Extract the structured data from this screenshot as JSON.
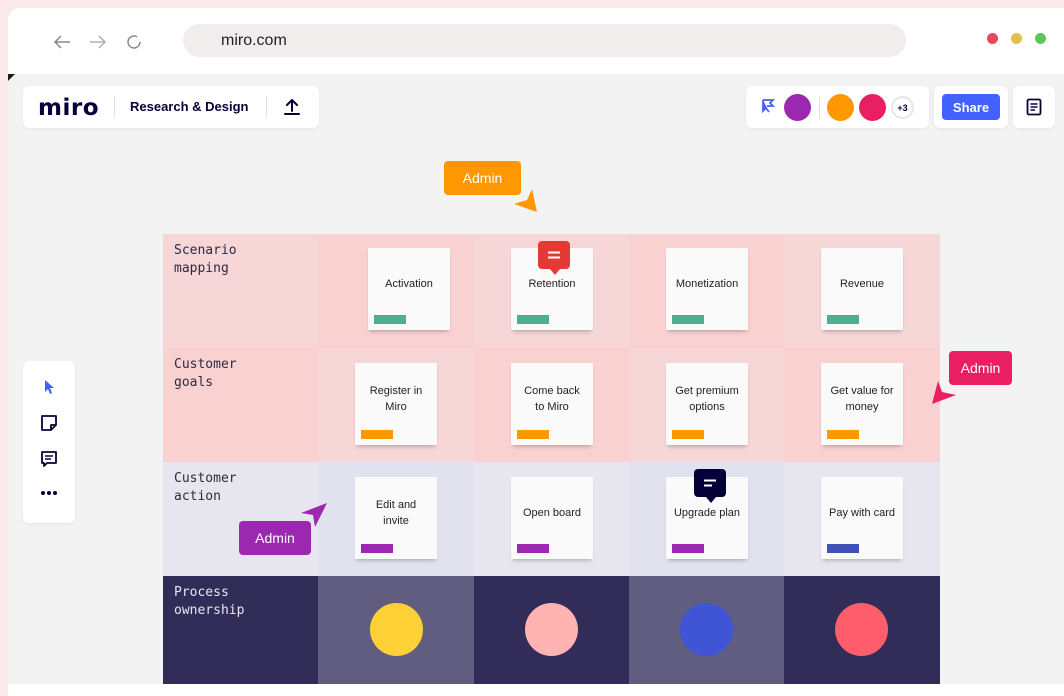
{
  "browser": {
    "url": "miro.com",
    "back_icon": "arrow-left-icon",
    "forward_icon": "arrow-right-icon",
    "reload_icon": "reload-icon",
    "window_dots": [
      "#e9485a",
      "#e0c14a",
      "#5ac85a"
    ]
  },
  "header": {
    "logo": "miro",
    "board_name": "Research & Design",
    "upload_icon": "upload-icon"
  },
  "collaborators": {
    "more_count": "+3",
    "avatar_colors": [
      "#9c27b0",
      "#ff9800",
      "#e91e63"
    ]
  },
  "share": {
    "label": "Share"
  },
  "toolbar": {
    "tools": [
      "cursor-icon",
      "sticky-note-icon",
      "comment-icon",
      "more-icon"
    ]
  },
  "board": {
    "rows": [
      {
        "label": "Scenario\nmapping",
        "stickies": [
          "Activation",
          "Retention",
          "Monetization",
          "Revenue"
        ],
        "tag_colors": [
          "#4caf8f",
          "#4caf8f",
          "#4caf8f",
          "#4caf8f"
        ]
      },
      {
        "label": "Customer\ngoals",
        "stickies": [
          "Register in\nMiro",
          "Come back\nto Miro",
          "Get premium\noptions",
          "Get value for\nmoney"
        ],
        "tag_colors": [
          "#ff9800",
          "#ff9800",
          "#ff9800",
          "#ff9800"
        ]
      },
      {
        "label": "Customer\naction",
        "stickies": [
          "Edit and\ninvite",
          "Open board",
          "Upgrade plan",
          "Pay with card"
        ],
        "tag_colors": [
          "#9c27b0",
          "#9c27b0",
          "#9c27b0",
          "#3f51b5"
        ]
      },
      {
        "label": "Process\nownership",
        "circle_colors": [
          "#fdd036",
          "#ffb3b3",
          "#4054d6",
          "#ff5c6c"
        ]
      }
    ]
  },
  "cursors": [
    {
      "label": "Admin",
      "color": "#ff9800"
    },
    {
      "label": "Admin",
      "color": "#e91e63"
    },
    {
      "label": "Admin",
      "color": "#9c27b0"
    }
  ],
  "comments": [
    {
      "icon": "comment-icon",
      "color": "#e53935"
    },
    {
      "icon": "comment-icon",
      "color": "#050038"
    }
  ]
}
